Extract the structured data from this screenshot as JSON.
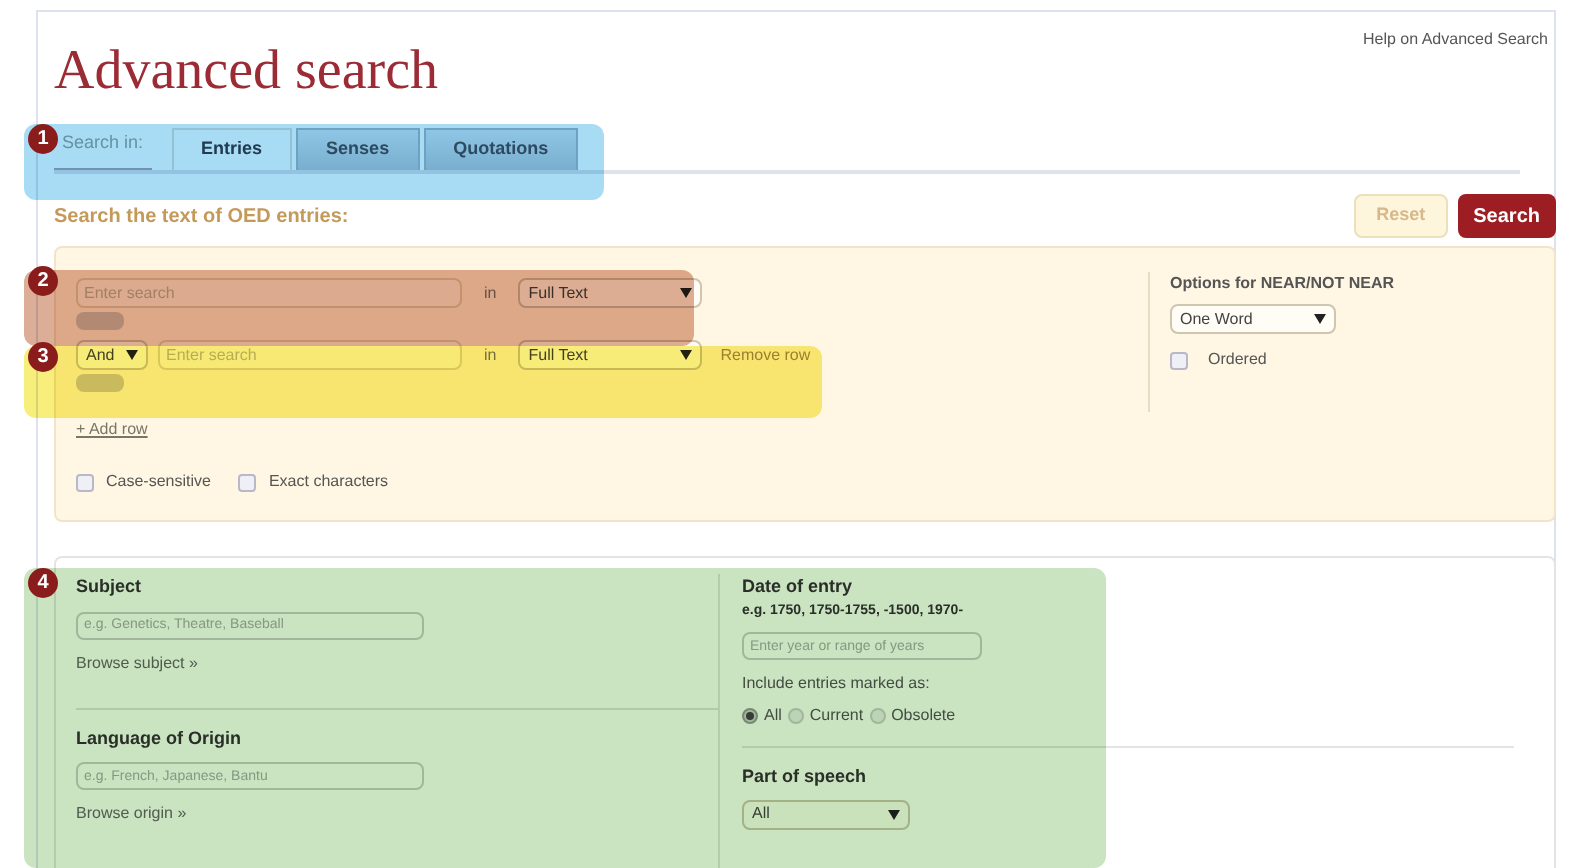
{
  "help_link": "Help on Advanced Search",
  "title": "Advanced search",
  "search_in": {
    "label": "Search in:",
    "tabs": [
      {
        "label": "Entries",
        "selected": true
      },
      {
        "label": "Senses",
        "selected": false
      },
      {
        "label": "Quotations",
        "selected": false
      }
    ]
  },
  "section_heading": "Search the text of OED entries:",
  "buttons": {
    "reset": "Reset",
    "search": "Search"
  },
  "query_rows": [
    {
      "placeholder": "Enter search",
      "in_label": "in",
      "field": "Full Text"
    },
    {
      "operator": "And",
      "placeholder": "Enter search",
      "in_label": "in",
      "field": "Full Text",
      "remove": "Remove row"
    }
  ],
  "add_row": "+ Add row",
  "options": [
    {
      "label": "Case-sensitive",
      "checked": false
    },
    {
      "label": "Exact characters",
      "checked": false
    }
  ],
  "near": {
    "title": "Options for NEAR/NOT NEAR",
    "distance": "One Word",
    "ordered": {
      "label": "Ordered",
      "checked": false
    }
  },
  "subject": {
    "label": "Subject",
    "placeholder": "e.g. Genetics, Theatre, Baseball",
    "browse": "Browse subject »"
  },
  "language": {
    "label": "Language of Origin",
    "placeholder": "e.g. French, Japanese, Bantu",
    "browse": "Browse origin »"
  },
  "date": {
    "label": "Date of entry",
    "hint": "e.g. 1750, 1750-1755, -1500, 1970-",
    "placeholder": "Enter year or range of years",
    "include_label": "Include entries marked as:",
    "statuses": [
      {
        "label": "All",
        "selected": true
      },
      {
        "label": "Current",
        "selected": false
      },
      {
        "label": "Obsolete",
        "selected": false
      }
    ]
  },
  "part_of_speech": {
    "label": "Part of speech",
    "value": "All"
  },
  "callouts": [
    {
      "number": "1",
      "color": "#a8dcf4"
    },
    {
      "number": "2",
      "color": "#dcae98"
    },
    {
      "number": "3",
      "color": "#f8ee7c"
    },
    {
      "number": "4",
      "color": "#cae4c2"
    }
  ]
}
